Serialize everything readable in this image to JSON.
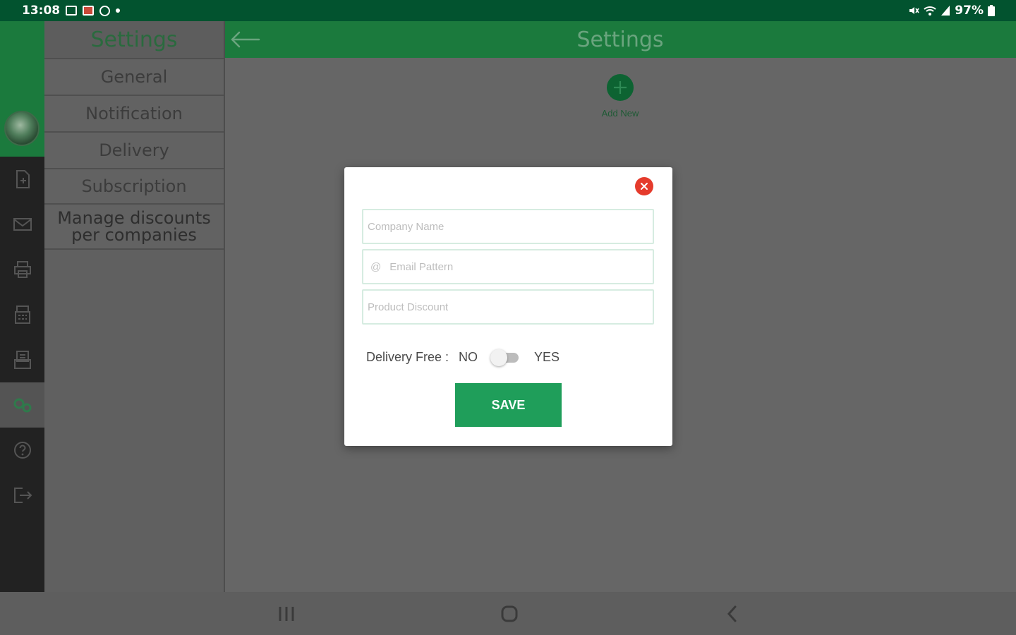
{
  "status_bar": {
    "time": "13:08",
    "battery": "97%",
    "left_icons": [
      "image-icon",
      "app-icon",
      "circle-icon",
      "dot-icon"
    ],
    "right_icons": [
      "mute-icon",
      "wifi-icon",
      "signal-icon",
      "battery-icon"
    ]
  },
  "header": {
    "title": "Settings",
    "back_icon": "back-arrow-icon"
  },
  "rail": {
    "items": [
      {
        "icon": "document-icon",
        "active": false
      },
      {
        "icon": "mail-icon",
        "active": false
      },
      {
        "icon": "printer-icon",
        "active": false
      },
      {
        "icon": "register-icon",
        "active": false
      },
      {
        "icon": "receipt-icon",
        "active": false
      },
      {
        "icon": "settings-gears-icon",
        "active": true
      },
      {
        "icon": "help-icon",
        "active": false
      },
      {
        "icon": "logout-icon",
        "active": false
      }
    ]
  },
  "side_menu": {
    "title": "Settings",
    "items": [
      {
        "label": "General"
      },
      {
        "label": "Notification"
      },
      {
        "label": "Delivery"
      },
      {
        "label": "Subscription"
      },
      {
        "label": "Manage discounts per companies"
      }
    ]
  },
  "main": {
    "add_new_label": "Add New"
  },
  "modal": {
    "fields": {
      "company_name_placeholder": "Company Name",
      "email_pattern_prefix": "@",
      "email_pattern_placeholder": "Email Pattern",
      "product_discount_placeholder": "Product Discount"
    },
    "delivery_free_label": "Delivery Free :",
    "toggle_off_label": "NO",
    "toggle_on_label": "YES",
    "toggle_state": false,
    "save_label": "SAVE"
  },
  "colors": {
    "status_bar": "#02532f",
    "header": "#1b7a3d",
    "save_button": "#1f9e5a",
    "close_button": "#e53b2c"
  }
}
